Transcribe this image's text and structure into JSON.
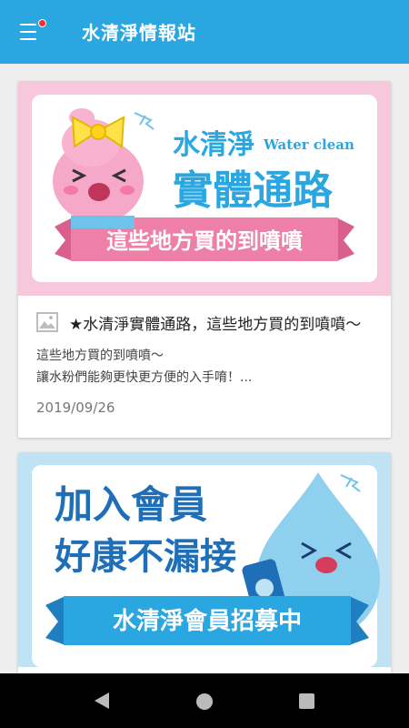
{
  "app": {
    "title": "水清淨情報站",
    "menu_icon": "hamburger-menu-icon",
    "notification_dot_color": "#ff2a2a",
    "accent": "#2aa7e0"
  },
  "posts": [
    {
      "banner": {
        "brand": "水清淨",
        "brand_en": "Water clean",
        "headline": "實體通路",
        "ribbon": "這些地方買的到噴噴",
        "bg": "#f7c8dc"
      },
      "title": "★水清淨實體通路，這些地方買的到噴噴～",
      "excerpt_lines": [
        "這些地方買的到噴噴～",
        "讓水粉們能夠更快更方便的入手唷！..."
      ],
      "date": "2019/09/26"
    },
    {
      "banner": {
        "line1": "加入會員",
        "line2": "好康不漏接",
        "ribbon": "水清淨會員招募中",
        "bg": "#bfe3f4"
      }
    }
  ],
  "navbar": {
    "back_icon": "back-triangle-icon",
    "home_icon": "home-circle-icon",
    "recent_icon": "recent-apps-square-icon"
  }
}
